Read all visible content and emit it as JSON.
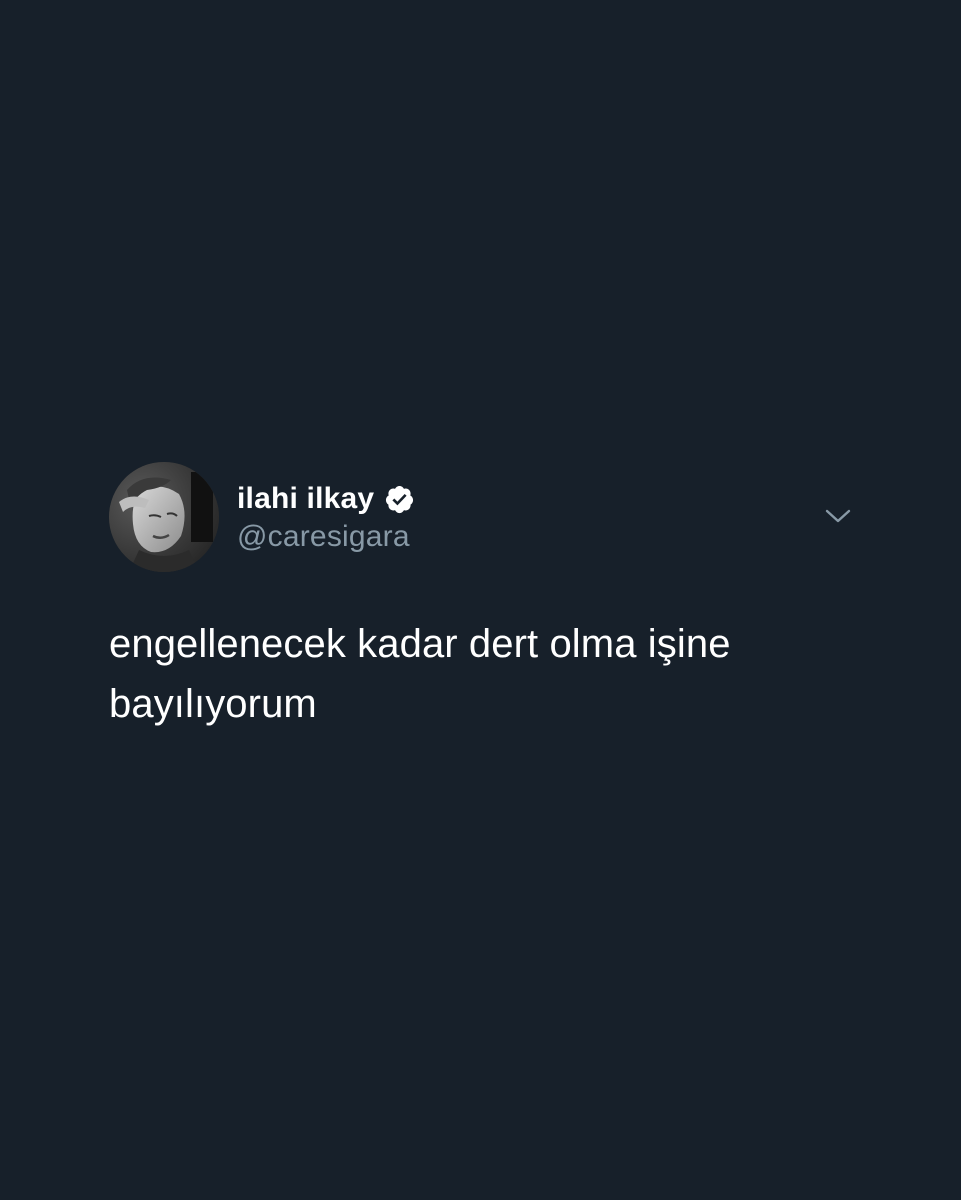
{
  "tweet": {
    "author": {
      "display_name": "ilahi ilkay",
      "handle": "@caresigara",
      "verified": true,
      "avatar_icon": "profile-photo-grayscale"
    },
    "text": "engellenecek kadar dert olma işine bayılıyorum",
    "menu_icon": "chevron-down-icon"
  },
  "colors": {
    "background": "#17202a",
    "text_primary": "#ffffff",
    "text_secondary": "#8899a6"
  }
}
